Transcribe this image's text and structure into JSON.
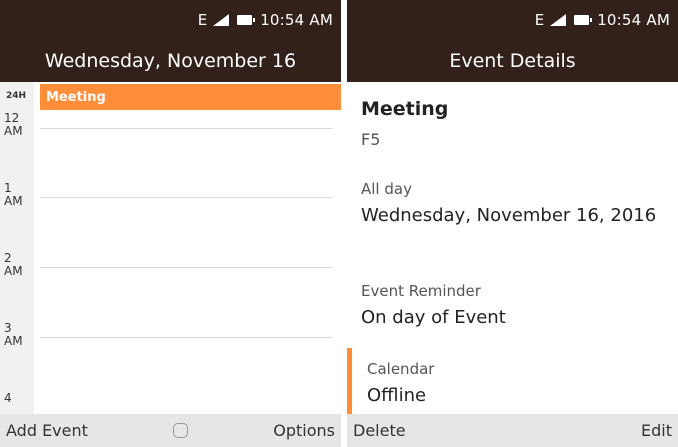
{
  "status": {
    "network": "E",
    "time": "10:54 AM"
  },
  "left": {
    "header": "Wednesday, November 16",
    "label_24h": "24H",
    "event_name": "Meeting",
    "hours": [
      "12\nAM",
      "1\nAM",
      "2\nAM",
      "3\nAM",
      "4"
    ],
    "softkeys": {
      "left": "Add Event",
      "right": "Options"
    }
  },
  "right": {
    "header": "Event Details",
    "title": "Meeting",
    "location": "F5",
    "allday_label": "All day",
    "date": "Wednesday, November 16, 2016",
    "reminder_label": "Event Reminder",
    "reminder_value": "On day of Event",
    "calendar_label": "Calendar",
    "calendar_value": "Offline",
    "softkeys": {
      "left": "Delete",
      "right": "Edit"
    }
  },
  "colors": {
    "statusbar": "#32211a",
    "accent": "#ff8d3a"
  }
}
